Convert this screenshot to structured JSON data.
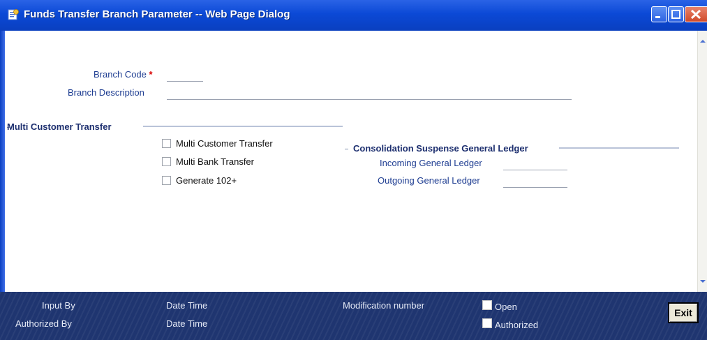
{
  "window": {
    "title": "Funds Transfer Branch Parameter -- Web Page Dialog"
  },
  "branch": {
    "code_label": "Branch Code",
    "required_mark": "*",
    "code_value": "",
    "description_label": "Branch Description",
    "description_value": ""
  },
  "multi_customer": {
    "section_title": "Multi Customer Transfer",
    "checkboxes": [
      {
        "label": "Multi Customer Transfer",
        "checked": false
      },
      {
        "label": "Multi Bank Transfer",
        "checked": false
      },
      {
        "label": "Generate 102+",
        "checked": false
      }
    ]
  },
  "consolidation": {
    "section_title": "Consolidation Suspense General Ledger",
    "incoming_label": "Incoming General Ledger",
    "incoming_value": "",
    "outgoing_label": "Outgoing General Ledger",
    "outgoing_value": ""
  },
  "footer": {
    "input_by_label": "Input By",
    "authorized_by_label": "Authorized By",
    "date_time_label_1": "Date Time",
    "date_time_label_2": "Date Time",
    "modification_label": "Modification number",
    "open_label": "Open",
    "authorized_label": "Authorized",
    "exit_label": "Exit"
  },
  "colors": {
    "titlebar": "#0b49d6",
    "footer": "#1f3570",
    "label_blue": "#1d3c91",
    "required_red": "#d80000"
  },
  "icons": {
    "title": "web-page-dialog-icon",
    "minimize": "minimize-icon",
    "maximize": "maximize-icon",
    "close": "close-icon",
    "scroll_up": "scroll-up-arrow-icon",
    "scroll_down": "scroll-down-arrow-icon"
  }
}
